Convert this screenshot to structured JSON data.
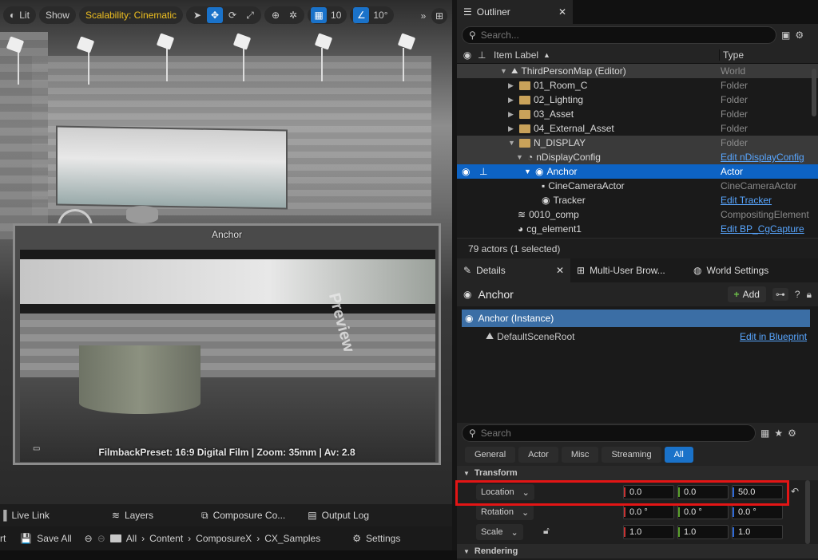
{
  "viewport": {
    "toolbar": {
      "lit": "Lit",
      "show": "Show",
      "scalability": "Scalability: Cinematic",
      "grid_snap": "10",
      "angle_snap": "10°"
    },
    "preview": {
      "title": "Anchor",
      "caption": "FilmbackPreset: 16:9 Digital Film | Zoom: 35mm | Av: 2.8",
      "watermark": "Preview"
    }
  },
  "bottom_tabs": [
    "Live Link",
    "Layers",
    "Composure Co...",
    "Output Log"
  ],
  "content_bar": {
    "start": "rt",
    "save_all": "Save All",
    "crumbs": [
      "All",
      "Content",
      "ComposureX",
      "CX_Samples"
    ],
    "settings": "Settings"
  },
  "outliner": {
    "tab": "Outliner",
    "search_placeholder": "Search...",
    "col_label": "Item Label",
    "col_type": "Type",
    "rows": [
      {
        "label": "ThirdPersonMap (Editor)",
        "type": "World"
      },
      {
        "label": "01_Room_C",
        "type": "Folder"
      },
      {
        "label": "02_Lighting",
        "type": "Folder"
      },
      {
        "label": "03_Asset",
        "type": "Folder"
      },
      {
        "label": "04_External_Asset",
        "type": "Folder"
      },
      {
        "label": "N_DISPLAY",
        "type": "Folder"
      },
      {
        "label": "nDisplayConfig",
        "type": "Edit nDisplayConfig"
      },
      {
        "label": "Anchor",
        "type": "Actor"
      },
      {
        "label": "CineCameraActor",
        "type": "CineCameraActor"
      },
      {
        "label": "Tracker",
        "type": "Edit Tracker"
      },
      {
        "label": "0010_comp",
        "type": "CompositingElement"
      },
      {
        "label": "cg_element1",
        "type": "Edit BP_CgCapture"
      }
    ],
    "footer": "79 actors (1 selected)"
  },
  "details": {
    "tabs": [
      "Details",
      "Multi-User Brow...",
      "World Settings"
    ],
    "actor_name": "Anchor",
    "add_label": "Add",
    "instance": "Anchor (Instance)",
    "root": "DefaultSceneRoot",
    "edit_blueprint": "Edit in Blueprint",
    "search_placeholder": "Search",
    "filters": [
      "General",
      "Actor",
      "Misc",
      "Streaming",
      "All"
    ],
    "section_transform": "Transform",
    "location_label": "Location",
    "rotation_label": "Rotation",
    "scale_label": "Scale",
    "location": [
      "0.0",
      "0.0",
      "50.0"
    ],
    "rotation": [
      "0.0 °",
      "0.0 °",
      "0.0 °"
    ],
    "scale": [
      "1.0",
      "1.0",
      "1.0"
    ],
    "section_rendering": "Rendering"
  },
  "colors": {
    "accent": "#1a72c9",
    "selection": "#0d63c4",
    "highlight_box": "#e31515"
  }
}
